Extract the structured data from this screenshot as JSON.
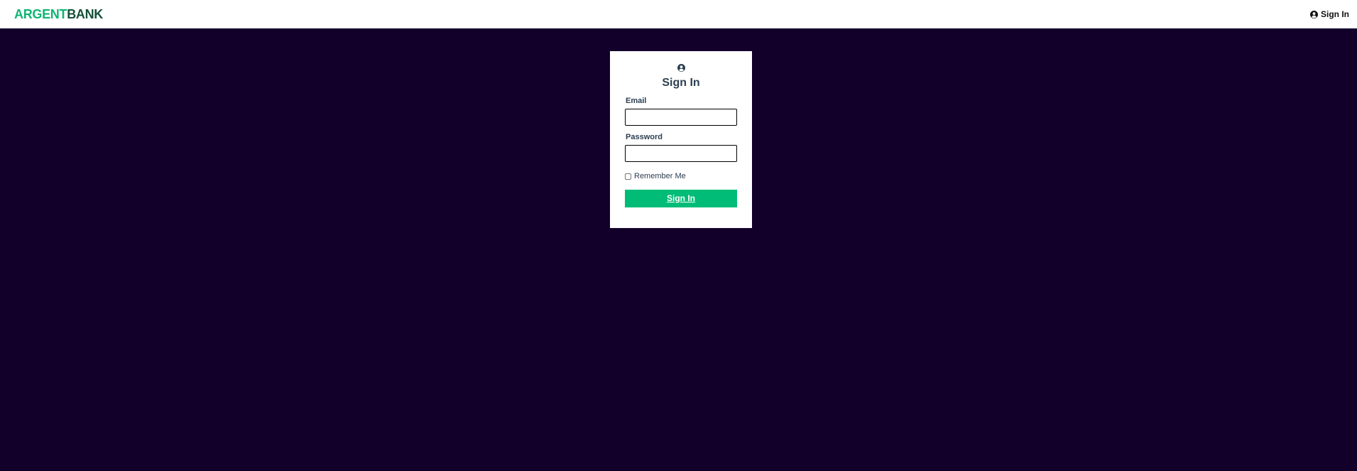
{
  "header": {
    "logo_part1": "ARGENT",
    "logo_part2": "BANK",
    "signin_label": "Sign In",
    "signin_icon": "user-circle-icon"
  },
  "login": {
    "title": "Sign In",
    "title_icon": "user-circle-icon",
    "email_label": "Email",
    "email_value": "",
    "password_label": "Password",
    "password_value": "",
    "remember_label": "Remember Me",
    "remember_checked": false,
    "submit_label": "Sign In"
  },
  "colors": {
    "page_background": "#12002b",
    "logo_accent": "#0fb472",
    "logo_dark": "#14503a",
    "button": "#00bc77",
    "text_dark": "#2c3e50"
  }
}
